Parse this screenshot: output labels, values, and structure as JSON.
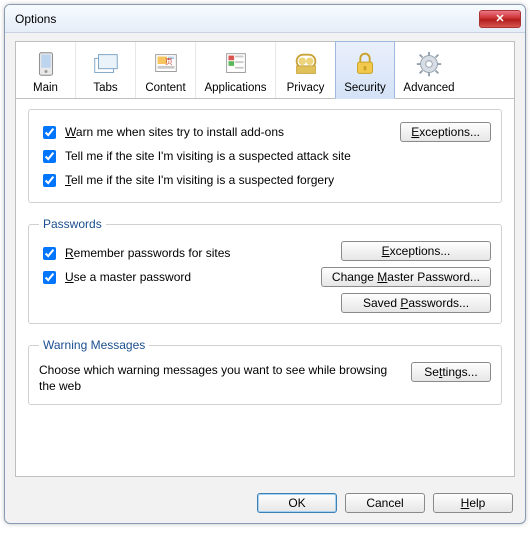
{
  "window": {
    "title": "Options"
  },
  "tabs": {
    "main": {
      "label": "Main",
      "icon": "main-icon"
    },
    "tabs": {
      "label": "Tabs",
      "icon": "tabs-icon"
    },
    "content": {
      "label": "Content",
      "icon": "content-icon"
    },
    "apps": {
      "label": "Applications",
      "icon": "applications-icon"
    },
    "privacy": {
      "label": "Privacy",
      "icon": "privacy-icon"
    },
    "security": {
      "label": "Security",
      "icon": "security-icon"
    },
    "advanced": {
      "label": "Advanced",
      "icon": "advanced-icon"
    },
    "active": "security"
  },
  "security_general": {
    "warn_addons": {
      "checked": true,
      "label_pre": "W",
      "label_post": "arn me when sites try to install add-ons"
    },
    "attack_site": {
      "checked": true,
      "label": "Tell me if the site I'm visiting is a suspected attack site"
    },
    "forgery": {
      "checked": true,
      "label_pre": "T",
      "label_post": "ell me if the site I'm visiting is a suspected forgery"
    },
    "exceptions_btn": "Exceptions..."
  },
  "passwords": {
    "legend": "Passwords",
    "remember": {
      "checked": true,
      "label_pre": "R",
      "label_post": "emember passwords for sites"
    },
    "master": {
      "checked": true,
      "label_pre": "U",
      "label_post": "se a master password"
    },
    "exceptions_btn": "Exceptions...",
    "change_master_btn_pre": "Change ",
    "change_master_btn_u": "M",
    "change_master_btn_post": "aster Password...",
    "saved_btn": "Saved Passwords..."
  },
  "warnings": {
    "legend": "Warning Messages",
    "message": "Choose which warning messages you want to see while browsing the web",
    "settings_btn_pre": "Se",
    "settings_btn_u": "t",
    "settings_btn_post": "tings..."
  },
  "footer": {
    "ok": "OK",
    "cancel": "Cancel",
    "help_pre": "H",
    "help_post": "elp"
  }
}
